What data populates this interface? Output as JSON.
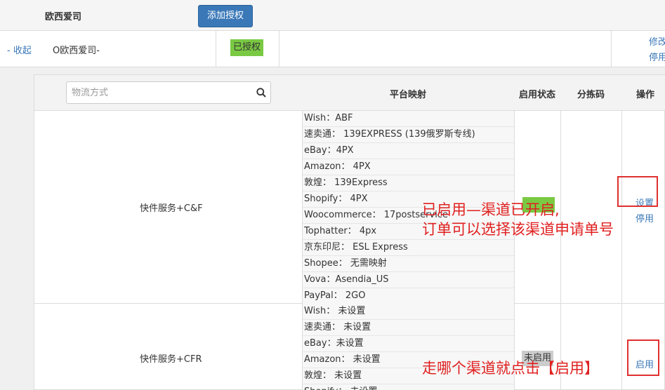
{
  "top_row": {
    "company_name": "欧西爱司",
    "add_auth_button": "添加授权"
  },
  "company_row": {
    "collapse_link": "- 收起",
    "name": "O欧西爱司-",
    "status_badge": "已授权",
    "modify_link": "修改",
    "disable_link": "停用"
  },
  "table": {
    "search": {
      "placeholder": "物流方式",
      "icon": "search-icon"
    },
    "headers": {
      "platform_mapping": "平台映射",
      "status": "启用状态",
      "sort_code": "分拣码",
      "actions": "操作"
    },
    "groups": [
      {
        "service": "快件服务+C&F",
        "mappings": [
          "Wish：ABF",
          "速卖通： 139EXPRESS (139俄罗斯专线)",
          "eBay：4PX",
          "Amazon： 4PX",
          "敦煌： 139Express",
          "Shopify： 4PX",
          "Woocommerce： 17postservice",
          "Tophatter： 4px",
          "京东印尼： ESL Express",
          "Shopee： 无需映射",
          "Vova：Asendia_US",
          "PayPal： 2GO"
        ],
        "status_label": "",
        "status_color": "#7ac943",
        "actions": {
          "settings": "设置",
          "disable": "停用"
        }
      },
      {
        "service": "快件服务+CFR",
        "mappings": [
          "Wish： 未设置",
          "速卖通： 未设置",
          "eBay：未设置",
          "Amazon： 未设置",
          "敦煌： 未设置",
          "Shopify： 未设置"
        ],
        "status_label": "未启用",
        "status_color": "#cccccc",
        "actions": {
          "enable": "启用"
        }
      }
    ]
  },
  "annotations": {
    "enabled_line1": "已启用—渠道已开启,",
    "enabled_line2": "订单可以选择该渠道申请单号",
    "how_to_enable": "走哪个渠道就点击【启用】",
    "color": "#e02020"
  }
}
